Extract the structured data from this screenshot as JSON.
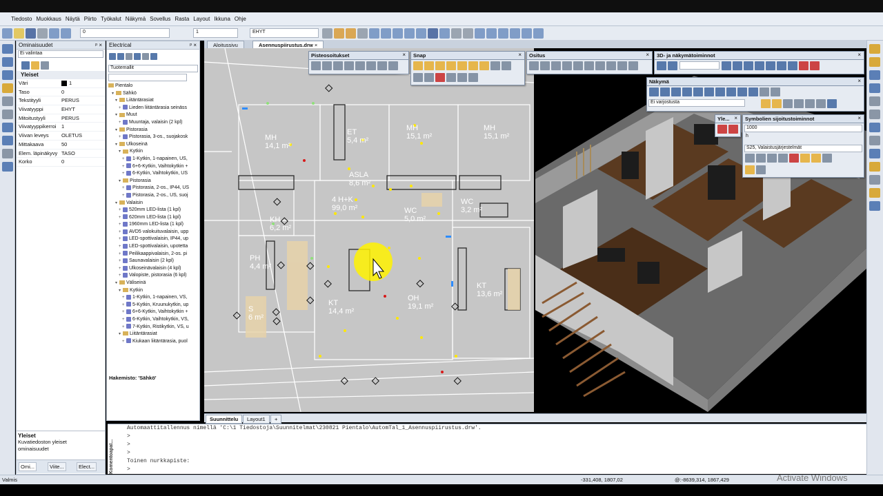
{
  "app": {
    "menu": [
      "Tiedosto",
      "Muokkaus",
      "Näytä",
      "Piirto",
      "Työkalut",
      "Näkymä",
      "Sovellus",
      "Rasta",
      "Layout",
      "Ikkuna",
      "Ohje"
    ],
    "toolbar": {
      "layer_value": "0",
      "pen_value": "1",
      "linetype_value": "EHYT"
    }
  },
  "properties": {
    "title": "Ominaisuudet",
    "selection": "Ei valintaa",
    "section": "Yleiset",
    "rows": [
      {
        "key": "Väri",
        "value": "1"
      },
      {
        "key": "Taso",
        "value": "0"
      },
      {
        "key": "Tekstityyli",
        "value": "PERUS"
      },
      {
        "key": "Viivatyyppi",
        "value": "EHYT"
      },
      {
        "key": "Mitoitustyyli",
        "value": "PERUS"
      },
      {
        "key": "Viivatyyppikerroi",
        "value": "1"
      },
      {
        "key": "Viivan leveys",
        "value": "OLETUS"
      },
      {
        "key": "Mittakaava",
        "value": "50"
      },
      {
        "key": "Elem. läpinäkyvy",
        "value": "TASO"
      },
      {
        "key": "Korko",
        "value": "0"
      }
    ],
    "desc_title": "Yleiset",
    "desc_text": "Kuvatiedoston yleiset ominaisuudet",
    "tabs": [
      "Omi...",
      "Viite...",
      "Elect..."
    ]
  },
  "electrical": {
    "title": "Electrical",
    "combo": "Tuotemallit",
    "tree": [
      {
        "level": 0,
        "type": "folder",
        "label": "Pientalo"
      },
      {
        "level": 1,
        "type": "folder",
        "label": "Sähkö"
      },
      {
        "level": 2,
        "type": "folder",
        "label": "Liitäntärasiat"
      },
      {
        "level": 3,
        "type": "comp",
        "label": "Lieden liitäntärasia seinäss"
      },
      {
        "level": 2,
        "type": "folder",
        "label": "Muut"
      },
      {
        "level": 3,
        "type": "comp",
        "label": "Muuntaja, valaisin (2 kpl)"
      },
      {
        "level": 2,
        "type": "folder",
        "label": "Pistorasia"
      },
      {
        "level": 3,
        "type": "comp",
        "label": "Pistorasia, 3-os., suojakosk"
      },
      {
        "level": 2,
        "type": "folder",
        "label": "Ulkoseinä"
      },
      {
        "level": 3,
        "type": "folder",
        "label": "Kytkin"
      },
      {
        "level": 4,
        "type": "comp",
        "label": "1-Kytkin, 1-napainen, US,"
      },
      {
        "level": 4,
        "type": "comp",
        "label": "6+6-Kytkin, Vaihtokytkin +"
      },
      {
        "level": 4,
        "type": "comp",
        "label": "6-Kytkin, Vaihtokytkin, US"
      },
      {
        "level": 3,
        "type": "folder",
        "label": "Pistorasia"
      },
      {
        "level": 4,
        "type": "comp",
        "label": "Pistorasia, 2-os., IP44, US"
      },
      {
        "level": 4,
        "type": "comp",
        "label": "Pistorasia, 2-os., US, suoj"
      },
      {
        "level": 2,
        "type": "folder",
        "label": "Valaisin"
      },
      {
        "level": 3,
        "type": "comp",
        "label": "520mm LED-lista (1 kpl)"
      },
      {
        "level": 3,
        "type": "comp",
        "label": "620mm LED-lista (1 kpl)"
      },
      {
        "level": 3,
        "type": "comp",
        "label": "1960mm LED-lista (1 kpl)"
      },
      {
        "level": 3,
        "type": "comp",
        "label": "AVD5 valokuituvalaisin, upp"
      },
      {
        "level": 3,
        "type": "comp",
        "label": "LED-spottivalaisin, IP44, up"
      },
      {
        "level": 3,
        "type": "comp",
        "label": "LED-spottivalaisin, upotetta"
      },
      {
        "level": 3,
        "type": "comp",
        "label": "Peilikaappivalaisin, 2-os. pi"
      },
      {
        "level": 3,
        "type": "comp",
        "label": "Saunavalaisin (2 kpl)"
      },
      {
        "level": 3,
        "type": "comp",
        "label": "Ulkoseinävalaisin (4 kpl)"
      },
      {
        "level": 3,
        "type": "comp",
        "label": "Valopiste, pistorasia (6 kpl)"
      },
      {
        "level": 2,
        "type": "folder",
        "label": "Väliseinä"
      },
      {
        "level": 3,
        "type": "folder",
        "label": "Kytkin"
      },
      {
        "level": 4,
        "type": "comp",
        "label": "1-Kytkin, 1-napainen, VS,"
      },
      {
        "level": 4,
        "type": "comp",
        "label": "5-Kytkin, Kruunukytkin, up"
      },
      {
        "level": 4,
        "type": "comp",
        "label": "6+6-Kytkin, Vaihtokytkin +"
      },
      {
        "level": 4,
        "type": "comp",
        "label": "6-Kytkin, Vaihtokytkin, VS,"
      },
      {
        "level": 4,
        "type": "comp",
        "label": "7-Kytkin, Ristikytkin, VS, u"
      },
      {
        "level": 3,
        "type": "folder",
        "label": "Liitäntärasiat"
      },
      {
        "level": 4,
        "type": "comp",
        "label": "Kiukaan liitäntärasia, puol"
      }
    ],
    "footer": "Hakemisto: 'Sähkö'"
  },
  "document_tabs": [
    "Aloitussivu",
    "Asennuspiirustus.drw"
  ],
  "windows": {
    "pisteosoitukset": "Pisteosoitukset",
    "snap": "Snap",
    "ositus": "Ositus",
    "view3d_tools": "3D- ja näkymätoiminnot",
    "nakyma": "Näkymä",
    "nakyma_combo": "Ei varjostusta",
    "yleis": "Yle...",
    "symbolit": "Symbolien sijoitustoiminnot",
    "symbolit_value": "1000",
    "symbolit_combo": "S25, Valaistusjärjestelmät"
  },
  "rooms": [
    {
      "name": "MH",
      "area": "14,1 m²"
    },
    {
      "name": "ET",
      "area": "5,4 m²"
    },
    {
      "name": "MH",
      "area": "15,1 m²"
    },
    {
      "name": "MH",
      "area": "15,1 m²"
    },
    {
      "name": "ASLA",
      "area": "8,6 m²"
    },
    {
      "name": "4 H+K",
      "area": "99,0 m²"
    },
    {
      "name": "WC",
      "area": "5,0 m²"
    },
    {
      "name": "WC",
      "area": "3,2 m²"
    },
    {
      "name": "KH",
      "area": "6,2 m²"
    },
    {
      "name": "PH",
      "area": "4,4 m²"
    },
    {
      "name": "S",
      "area": "6 m²"
    },
    {
      "name": "KT",
      "area": "14,4 m²"
    },
    {
      "name": "OH",
      "area": "19,1 m²"
    },
    {
      "name": "KT",
      "area": "13,6 m²"
    }
  ],
  "layout_tabs": [
    "Suunnittelu",
    "Layout1",
    "+"
  ],
  "command": {
    "label": "Komentoapal...",
    "lines": [
      "Automaattitallennus nimellä 'C:\\1 Tiedostoja\\Suunnitelmat\\230821 Pientalo\\AutomTal_1_Asennuspiirustus.drw'.",
      ">",
      ">",
      ">",
      "Toinen nurkkapiste:",
      ">"
    ]
  },
  "status": {
    "left": "Valmis",
    "coords1": "-331,408, 1807,02",
    "coords2": "@:-8639,314, 1867,429",
    "watermark": "Activate Windows"
  }
}
